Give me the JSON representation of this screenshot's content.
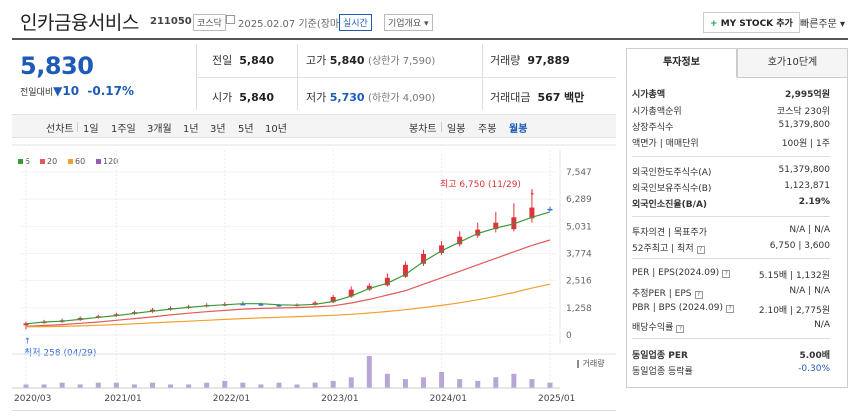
{
  "header": {
    "company": "인카금융서비스",
    "code": "211050",
    "market_badge": "코스닥",
    "date_text": "2025.02.07  기준(장마감)",
    "realtime_badge": "실시간",
    "overview_dropdown": "기업개요",
    "my_stock_button": "MY STOCK 추가",
    "quick_order": "빠른주문"
  },
  "price": {
    "current": "5,830",
    "change_label": "전일대비",
    "change_arrow": "▼",
    "change_value": "10",
    "change_pct": "-0.17%"
  },
  "summary": {
    "prev_label": "전일",
    "prev_value": "5,840",
    "high_label": "고가",
    "high_value": "5,840",
    "upper_limit": "(상한가 7,590)",
    "volume_label": "거래량",
    "volume_value": "97,889",
    "open_label": "시가",
    "open_value": "5,840",
    "low_label": "저가",
    "low_value": "5,730",
    "lower_limit": "(하한가 4,090)",
    "amount_label": "거래대금",
    "amount_value": "567",
    "amount_unit": "백만"
  },
  "toolbar": {
    "line_chart_label": "선차트",
    "line_periods": [
      "1일",
      "1주일",
      "3개월",
      "1년",
      "3년",
      "5년",
      "10년"
    ],
    "candle_chart_label": "봉차트",
    "candle_periods": [
      "일봉",
      "주봉",
      "월봉"
    ],
    "candle_selected": "월봉"
  },
  "chart_data": {
    "type": "line",
    "legend": [
      {
        "name": "5",
        "color": "#3a9a3a"
      },
      {
        "name": "20",
        "color": "#e05a5a"
      },
      {
        "name": "60",
        "color": "#f0a030"
      },
      {
        "name": "120",
        "color": "#9b59b6"
      }
    ],
    "y_ticks": [
      "7,547",
      "6,289",
      "5,031",
      "3,774",
      "2,516",
      "1,258",
      "0"
    ],
    "ylim": [
      0,
      7547
    ],
    "x_ticks": [
      "2020/03",
      "2021/01",
      "2022/01",
      "2023/01",
      "2024/01",
      "2025/01"
    ],
    "high_annotation": "최고 6,750 (11/29)",
    "low_annotation": "최저 258 (04/29)",
    "volume_label": "거래량",
    "x": [
      "2020/03",
      "2020/05",
      "2020/07",
      "2020/09",
      "2020/11",
      "2021/01",
      "2021/03",
      "2021/05",
      "2021/07",
      "2021/09",
      "2021/11",
      "2022/01",
      "2022/03",
      "2022/05",
      "2022/07",
      "2022/09",
      "2022/11",
      "2023/01",
      "2023/03",
      "2023/05",
      "2023/07",
      "2023/09",
      "2023/11",
      "2024/01",
      "2024/03",
      "2024/05",
      "2024/07",
      "2024/09",
      "2024/11",
      "2025/01"
    ],
    "series": [
      {
        "name": "5",
        "values": [
          520,
          600,
          640,
          720,
          820,
          900,
          1000,
          1100,
          1200,
          1280,
          1350,
          1400,
          1450,
          1450,
          1400,
          1380,
          1420,
          1550,
          1800,
          2150,
          2400,
          2800,
          3400,
          3900,
          4300,
          4700,
          4950,
          5150,
          5450,
          5700
        ]
      },
      {
        "name": "20",
        "values": [
          400,
          440,
          480,
          540,
          600,
          680,
          760,
          840,
          930,
          1010,
          1080,
          1140,
          1200,
          1230,
          1250,
          1270,
          1300,
          1350,
          1480,
          1650,
          1850,
          2050,
          2350,
          2650,
          2950,
          3250,
          3550,
          3850,
          4150,
          4400
        ]
      },
      {
        "name": "60",
        "values": [
          380,
          390,
          400,
          420,
          450,
          480,
          520,
          560,
          600,
          640,
          680,
          720,
          760,
          790,
          820,
          850,
          880,
          910,
          960,
          1020,
          1090,
          1170,
          1270,
          1370,
          1490,
          1630,
          1790,
          1970,
          2170,
          2350
        ]
      }
    ],
    "candles": {
      "open": [
        450,
        560,
        600,
        700,
        800,
        880,
        980,
        1080,
        1180,
        1260,
        1330,
        1390,
        1440,
        1430,
        1390,
        1370,
        1400,
        1520,
        1780,
        2100,
        2300,
        2700,
        3300,
        3800,
        4200,
        4600,
        4900,
        4900,
        5400,
        5840
      ],
      "close": [
        540,
        620,
        680,
        790,
        870,
        960,
        1060,
        1170,
        1250,
        1320,
        1390,
        1430,
        1420,
        1380,
        1360,
        1410,
        1500,
        1760,
        2100,
        2280,
        2650,
        3250,
        3750,
        4150,
        4550,
        4880,
        5200,
        5450,
        5900,
        5830
      ],
      "high": [
        620,
        700,
        760,
        860,
        940,
        1040,
        1140,
        1250,
        1330,
        1400,
        1470,
        1520,
        1560,
        1500,
        1440,
        1460,
        1580,
        1850,
        2250,
        2400,
        2850,
        3400,
        3950,
        4350,
        4800,
        5200,
        5700,
        6100,
        6750,
        5950
      ],
      "low": [
        258,
        520,
        560,
        650,
        760,
        840,
        930,
        1030,
        1130,
        1200,
        1280,
        1330,
        1380,
        1340,
        1300,
        1320,
        1360,
        1480,
        1720,
        2050,
        2250,
        2650,
        3200,
        3700,
        4100,
        4500,
        4750,
        4800,
        5200,
        5730
      ]
    },
    "volume": [
      2,
      2,
      3,
      2,
      3,
      3,
      2,
      3,
      2,
      2,
      3,
      4,
      3,
      2,
      3,
      2,
      3,
      4,
      6,
      18,
      8,
      5,
      6,
      9,
      5,
      4,
      6,
      8,
      5,
      3
    ]
  },
  "right_panel": {
    "tabs": [
      "투자정보",
      "호가10단계"
    ],
    "rows": [
      {
        "label": "시가총액",
        "value": "2,995억원",
        "bold": true
      },
      {
        "label": "시가총액순위",
        "value": "코스닥 230위"
      },
      {
        "label": "상장주식수",
        "value": "51,379,800"
      },
      {
        "label": "액면가 | 매매단위",
        "value": "100원 | 1주"
      },
      {
        "label": "외국인한도주식수(A)",
        "value": "51,379,800"
      },
      {
        "label": "외국인보유주식수(B)",
        "value": "1,123,871"
      },
      {
        "label": "외국인소진율(B/A)",
        "value": "2.19%",
        "bold": true
      },
      {
        "label": "투자의견 | 목표주가",
        "value": "N/A | N/A"
      },
      {
        "label": "52주최고 | 최저",
        "value": "6,750 | 3,600"
      },
      {
        "label": "PER | EPS(2024.09)",
        "value": "5.15배 | 1,132원"
      },
      {
        "label": "추정PER | EPS",
        "value": "N/A | N/A"
      },
      {
        "label": "PBR | BPS (2024.09)",
        "value": "2.10배 | 2,775원"
      },
      {
        "label": "배당수익률",
        "value": "N/A"
      },
      {
        "label": "동일업종 PER",
        "value": "5.00배",
        "bold": true
      },
      {
        "label": "동일업종 등락률",
        "value": "-0.30%"
      }
    ]
  }
}
